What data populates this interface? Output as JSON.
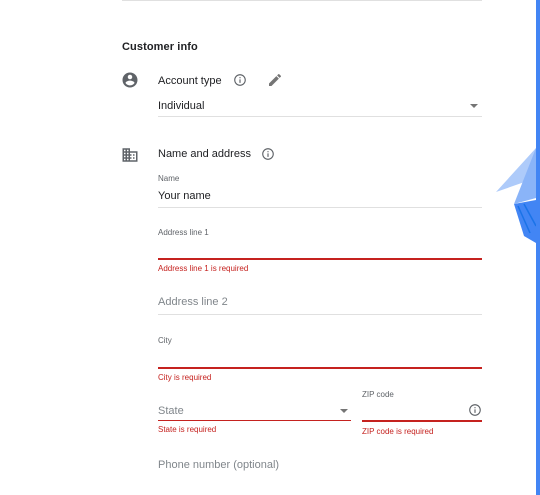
{
  "section": {
    "title": "Customer info"
  },
  "account": {
    "title": "Account type",
    "value": "Individual",
    "icons": {
      "row": "account-circle-icon",
      "info": "info-icon",
      "edit": "pencil-icon"
    }
  },
  "name_address": {
    "title": "Name and address",
    "icons": {
      "row": "building-icon",
      "info": "info-icon"
    },
    "name": {
      "label": "Name",
      "value": "Your name"
    },
    "address1": {
      "label": "Address line 1",
      "value": "",
      "error": "Address line 1 is required"
    },
    "address2": {
      "placeholder": "Address line 2"
    },
    "city": {
      "label": "City",
      "value": "",
      "error": "City is required"
    },
    "state": {
      "placeholder": "State",
      "error": "State is required"
    },
    "zip": {
      "label": "ZIP code",
      "value": "",
      "error": "ZIP code is required"
    },
    "phone": {
      "placeholder": "Phone number (optional)"
    }
  },
  "colors": {
    "accent": "#4285f4",
    "error": "#c5221f",
    "divider": "#e0e0e0"
  }
}
